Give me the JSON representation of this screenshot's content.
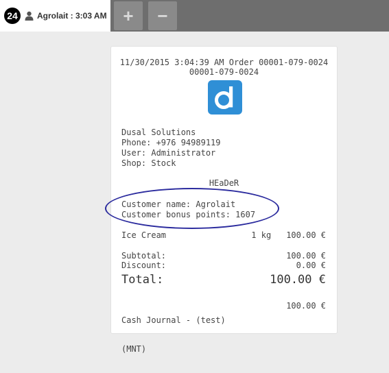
{
  "tab": {
    "number": "24",
    "label": "Agrolait : 3:03 AM",
    "add_label": "+",
    "remove_label": "−"
  },
  "receipt": {
    "header_line1": "11/30/2015 3:04:39 AM Order 00001-079-0024",
    "header_line2": "00001-079-0024",
    "logo": "d-logo",
    "company": "Dusal Solutions",
    "phone": "Phone: +976 94989119",
    "user": "User: Administrator",
    "shop": "Shop: Stock",
    "header_text": "HEaDeR",
    "customer_name": "Customer name: Agrolait",
    "customer_points": "Customer bonus points: 1607",
    "items": [
      {
        "name": "Ice Cream",
        "qty": "1 kg",
        "price": "100.00 €"
      }
    ],
    "subtotal_label": "Subtotal:",
    "subtotal_value": "100.00 €",
    "discount_label": "Discount:",
    "discount_value": "0.00 €",
    "total_label": "Total:",
    "total_value": "100.00 €",
    "payment_label_line1": "Cash Journal - (test)",
    "payment_label_line2": "(MNT)",
    "payment_value": "100.00 €"
  },
  "colors": {
    "topbar": "#6e6e6e",
    "logo": "#2f8fd6",
    "annotation_circle": "#2b2b9e"
  }
}
